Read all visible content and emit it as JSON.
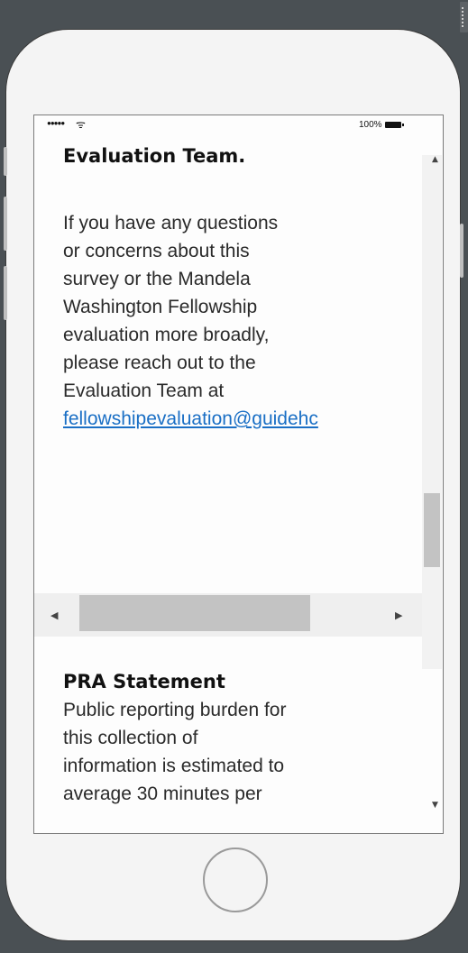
{
  "status_bar": {
    "signal": "●●●●●",
    "wifi": "ᯤ",
    "battery_percent": "100%"
  },
  "section1": {
    "heading_tail": "Evaluation Team.",
    "lines": [
      "If you have any questions",
      "or concerns about this",
      "survey or the Mandela",
      "Washington Fellowship",
      "evaluation more broadly,",
      "please reach out to the",
      "Evaluation Team at"
    ],
    "email_link": "fellowshipevaluation@guidehc"
  },
  "section2": {
    "heading": "PRA Statement",
    "lines": [
      "Public reporting burden for",
      "this collection of",
      "information is estimated to",
      "average 30 minutes per"
    ]
  },
  "scroll": {
    "arrow_up": "▲",
    "arrow_down": "▼",
    "arrow_left": "◀",
    "arrow_right": "▶"
  }
}
